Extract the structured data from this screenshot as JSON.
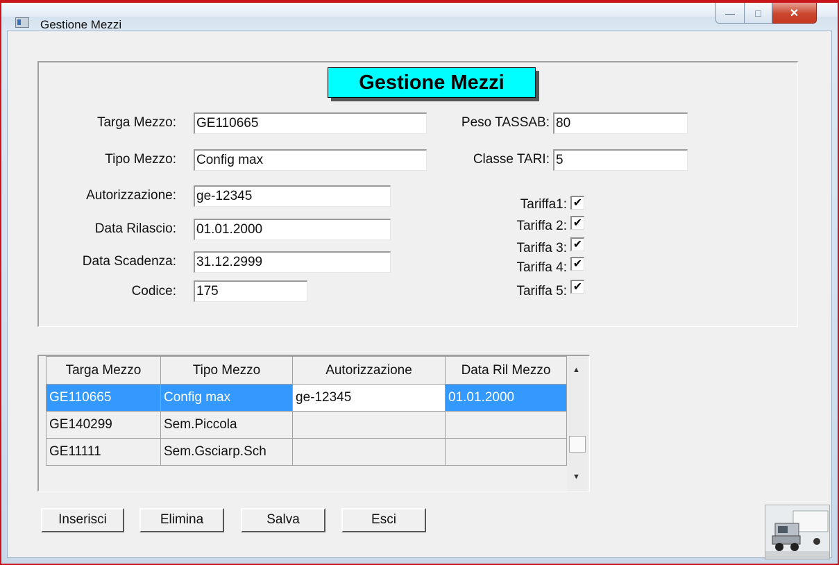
{
  "window": {
    "title": "Gestione Mezzi",
    "controls": {
      "minimize": "—",
      "maximize": "□",
      "close": "✕"
    }
  },
  "form": {
    "heading": "Gestione Mezzi",
    "targa": {
      "label": "Targa Mezzo:",
      "value": "GE110665"
    },
    "tipo": {
      "label": "Tipo Mezzo:",
      "value": "Config max"
    },
    "autorizzazione": {
      "label": "Autorizzazione:",
      "value": "ge-12345"
    },
    "data_rilascio": {
      "label": "Data Rilascio:",
      "value": "01.01.2000"
    },
    "data_scadenza": {
      "label": "Data Scadenza:",
      "value": "31.12.2999"
    },
    "codice": {
      "label": "Codice:",
      "value": "175"
    },
    "peso": {
      "label": "Peso TASSAB:",
      "value": "80"
    },
    "classe": {
      "label": "Classe TARI:",
      "value": "5"
    },
    "tariffe": [
      {
        "label": "Tariffa1:",
        "checked": true,
        "mark": "✔"
      },
      {
        "label": "Tariffa 2:",
        "checked": true,
        "mark": "✔"
      },
      {
        "label": "Tariffa 3:",
        "checked": true,
        "mark": "✔"
      },
      {
        "label": "Tariffa 4:",
        "checked": true,
        "mark": "✔"
      },
      {
        "label": "Tariffa 5:",
        "checked": true,
        "mark": "✔"
      }
    ]
  },
  "grid": {
    "columns": [
      "Targa Mezzo",
      "Tipo Mezzo",
      "Autorizzazione",
      "Data Ril Mezzo"
    ],
    "rows": [
      [
        "GE110665",
        "Config max",
        "ge-12345",
        "01.01.2000"
      ],
      [
        "GE140299",
        "Sem.Piccola",
        "",
        ""
      ],
      [
        "GE11111",
        "Sem.Gsciarp.Sch",
        "",
        ""
      ]
    ],
    "selected_row": 0
  },
  "buttons": {
    "inserisci": "Inserisci",
    "elimina": "Elimina",
    "salva": "Salva",
    "esci": "Esci"
  },
  "icons": {
    "app": "window-icon",
    "logo": "truck-icon",
    "scroll_up": "▲",
    "scroll_down": "▼"
  }
}
